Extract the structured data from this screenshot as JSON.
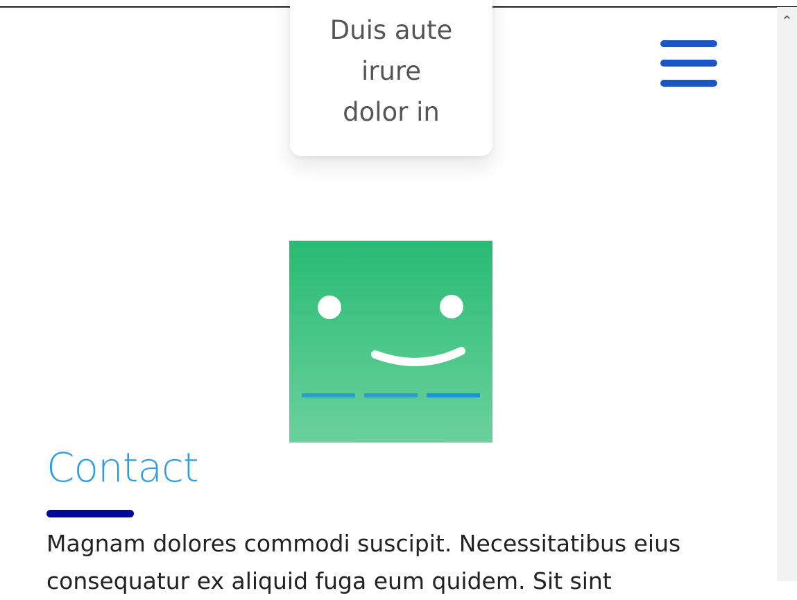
{
  "card": {
    "text": "Duis aute\nirure\ndolor in"
  },
  "menu": {
    "icon": "hamburger-menu-icon",
    "color": "#1a56c8"
  },
  "logo": {
    "icon": "smiley-face-logo",
    "gradient_top": "#29bb73",
    "gradient_bottom": "#6ad19d",
    "dash_color": "#1b93d8"
  },
  "contact": {
    "title": "Contact",
    "title_color": "#2b9ee5",
    "underline_color": "#000a99",
    "body": "Magnam dolores commodi suscipit. Necessitatibus eius consequatur ex aliquid fuga eum quidem. Sit sint"
  },
  "scrollbar": {
    "up_icon": "chevron-up-icon"
  }
}
